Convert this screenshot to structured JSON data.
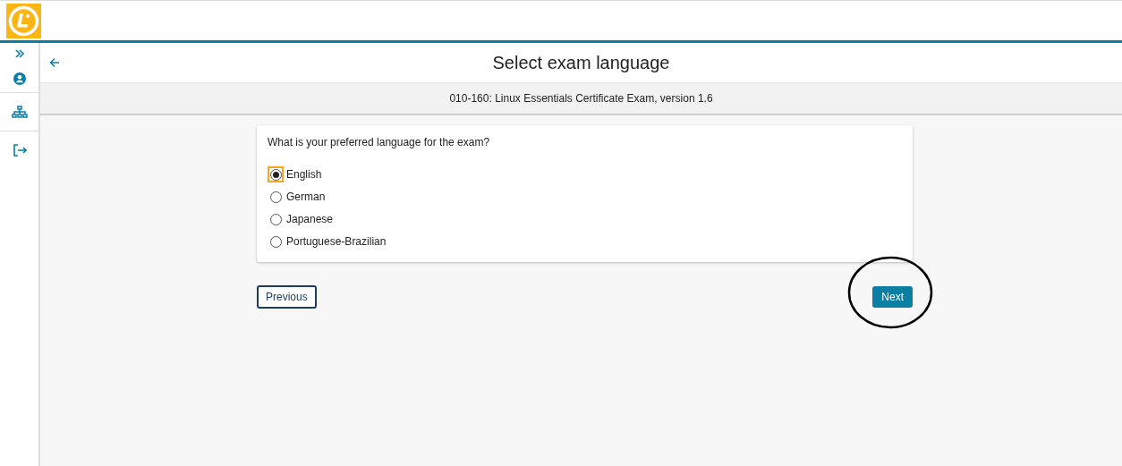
{
  "header": {
    "title": "Select exam language",
    "subtitle": "010-160: Linux Essentials Certificate Exam, version 1.6"
  },
  "question": {
    "prompt": "What is your preferred language for the exam?",
    "options": [
      {
        "label": "English",
        "selected": true
      },
      {
        "label": "German",
        "selected": false
      },
      {
        "label": "Japanese",
        "selected": false
      },
      {
        "label": "Portuguese-Brazilian",
        "selected": false
      }
    ]
  },
  "buttons": {
    "previous": "Previous",
    "next": "Next"
  }
}
